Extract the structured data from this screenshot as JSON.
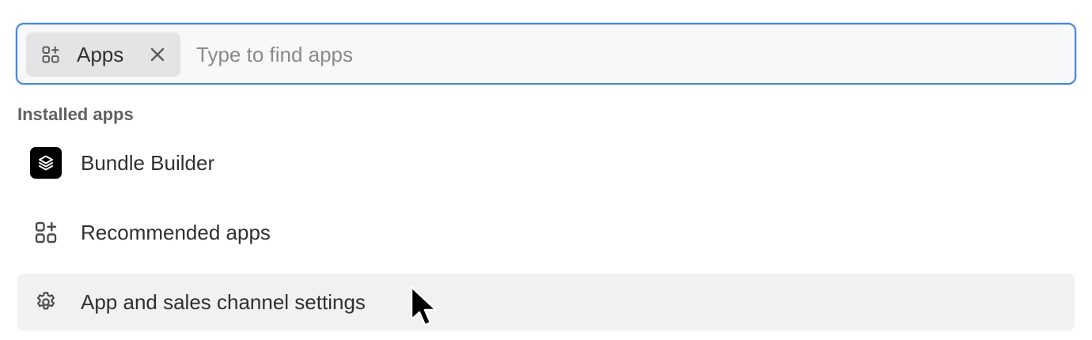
{
  "search": {
    "chip_label": "Apps",
    "chip_icon": "apps-icon",
    "chip_close_icon": "close-icon",
    "placeholder": "Type to find apps",
    "value": ""
  },
  "installed_section": {
    "heading": "Installed apps"
  },
  "items": [
    {
      "label": "Bundle Builder",
      "icon": "bundle-builder-app-icon"
    },
    {
      "label": "Recommended apps",
      "icon": "apps-add-icon"
    },
    {
      "label": "App and sales channel settings",
      "icon": "gear-icon"
    }
  ],
  "colors": {
    "focus_border": "#4a86d8",
    "chip_background": "#e3e4e6",
    "hover_background": "#f1f1f1",
    "heading_text": "#616161"
  }
}
